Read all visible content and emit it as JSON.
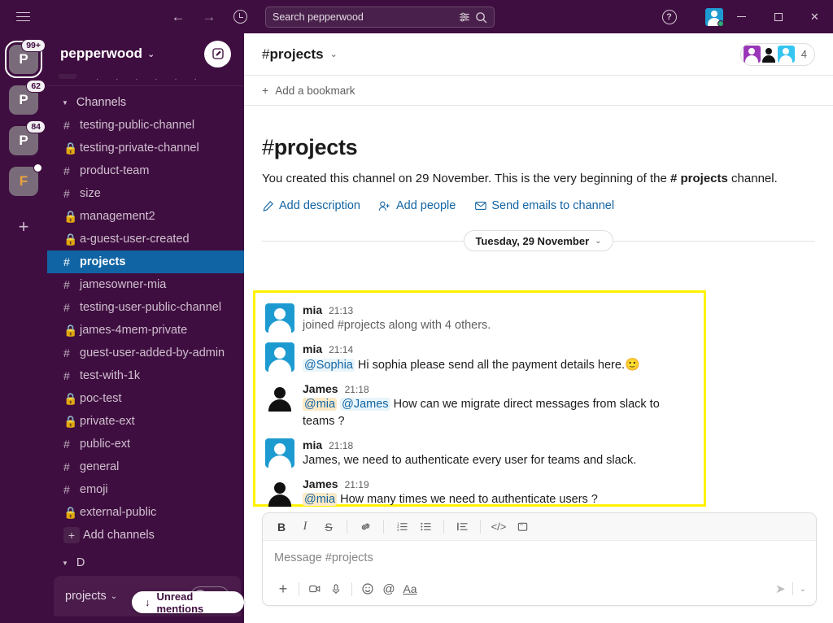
{
  "titlebar": {
    "menu_icon": "hamburger-icon",
    "back_icon": "arrow-left-icon",
    "forward_icon": "arrow-right-icon",
    "history_icon": "clock-icon",
    "search_placeholder": "Search pepperwood",
    "filter_icon": "search-filter-icon",
    "search_icon": "search-icon",
    "help_label": "?",
    "minimize_label": "minimize",
    "maximize_label": "maximize",
    "close_label": "✕"
  },
  "rail": {
    "workspaces": [
      {
        "letter": "P",
        "badge": "99+",
        "active": true,
        "dot": false
      },
      {
        "letter": "P",
        "badge": "62",
        "active": false,
        "dot": false
      },
      {
        "letter": "P",
        "badge": "84",
        "active": false,
        "dot": false
      },
      {
        "letter": "F",
        "badge": "",
        "active": false,
        "dot": true
      }
    ],
    "add_label": "+"
  },
  "sidebar": {
    "workspace_name": "pepperwood",
    "caret": "⌄",
    "compose_icon": "compose-icon",
    "section": {
      "label": "Channels",
      "expanded_caret": "▼"
    },
    "channels": [
      {
        "name": "testing-public-channel",
        "type": "public",
        "selected": false
      },
      {
        "name": "testing-private-channel",
        "type": "private",
        "selected": false
      },
      {
        "name": "product-team",
        "type": "public",
        "selected": false
      },
      {
        "name": "size",
        "type": "public",
        "selected": false
      },
      {
        "name": "management2",
        "type": "private",
        "selected": false
      },
      {
        "name": "a-guest-user-created",
        "type": "private",
        "selected": false
      },
      {
        "name": "projects",
        "type": "public",
        "selected": true
      },
      {
        "name": "jamesowner-mia",
        "type": "public",
        "selected": false
      },
      {
        "name": "testing-user-public-channel",
        "type": "public",
        "selected": false
      },
      {
        "name": "james-4mem-private",
        "type": "private",
        "selected": false
      },
      {
        "name": "guest-user-added-by-admin",
        "type": "public",
        "selected": false
      },
      {
        "name": "test-with-1k",
        "type": "public",
        "selected": false
      },
      {
        "name": "poc-test",
        "type": "private",
        "selected": false
      },
      {
        "name": "private-ext",
        "type": "private",
        "selected": false
      },
      {
        "name": "public-ext",
        "type": "public",
        "selected": false
      },
      {
        "name": "general",
        "type": "public",
        "selected": false
      },
      {
        "name": "emoji",
        "type": "public",
        "selected": false
      },
      {
        "name": "external-public",
        "type": "private",
        "selected": false
      }
    ],
    "add_channels_label": "Add channels",
    "unread_mentions_label": "Unread mentions",
    "unread_mentions_arrow": "↓",
    "footer": {
      "label": "projects",
      "caret": "⌄",
      "headphones_icon": "headphones-icon"
    }
  },
  "channel_header": {
    "hash": "#",
    "name": "projects",
    "caret": "⌄",
    "member_count": "4",
    "bookmark_plus": "+",
    "bookmark_label": "Add a bookmark"
  },
  "intro": {
    "hash": "#",
    "title": "projects",
    "body_part1": "You created this channel on 29 November. This is the very beginning of the ",
    "body_bold": "# projects",
    "body_part2": " channel.",
    "actions": [
      {
        "icon": "pencil-icon",
        "label": "Add description"
      },
      {
        "icon": "add-person-icon",
        "label": "Add people"
      },
      {
        "icon": "email-icon",
        "label": "Send emails to channel"
      }
    ]
  },
  "date_divider": {
    "label": "Tuesday, 29 November",
    "caret": "⌄"
  },
  "messages": [
    {
      "author": "mia",
      "time": "21:13",
      "avatar": "blue",
      "system": true,
      "text": "joined #projects along with 4 others.",
      "mentions": []
    },
    {
      "author": "mia",
      "time": "21:14",
      "avatar": "blue",
      "system": false,
      "mention1": "@Sophia",
      "text": "Hi sophia please send all the payment details here.",
      "emoji": "🙂"
    },
    {
      "author": "James",
      "time": "21:18",
      "avatar": "dark",
      "system": false,
      "mention1": "@mia",
      "mention2": "@James",
      "text": "How can we migrate direct messages from slack to teams ?"
    },
    {
      "author": "mia",
      "time": "21:18",
      "avatar": "blue",
      "system": false,
      "text": "James, we need to authenticate every user for teams and slack."
    },
    {
      "author": "James",
      "time": "21:19",
      "avatar": "dark",
      "system": false,
      "mention1": "@mia",
      "text": "How many times we need to authenticate users ?"
    }
  ],
  "composer": {
    "placeholder": "Message #projects",
    "toolbar": [
      {
        "icon": "bold-icon",
        "label": "B"
      },
      {
        "icon": "italic-icon",
        "label": "I"
      },
      {
        "icon": "strikethrough-icon",
        "label": "S"
      },
      {
        "icon": "link-icon",
        "label": "link"
      },
      {
        "icon": "ordered-list-icon",
        "label": "ol"
      },
      {
        "icon": "bulleted-list-icon",
        "label": "ul"
      },
      {
        "icon": "blockquote-icon",
        "label": "quote"
      },
      {
        "icon": "code-icon",
        "label": "</>"
      },
      {
        "icon": "code-block-icon",
        "label": "codeblock"
      }
    ],
    "bottom": [
      {
        "icon": "plus-icon",
        "label": "+"
      },
      {
        "icon": "video-icon",
        "label": "video"
      },
      {
        "icon": "microphone-icon",
        "label": "mic"
      },
      {
        "icon": "emoji-icon",
        "label": "emoji"
      },
      {
        "icon": "mention-icon",
        "label": "@"
      },
      {
        "icon": "format-text-icon",
        "label": "Aa"
      }
    ],
    "send_icon": "send-icon",
    "send_caret": "⌄"
  },
  "colors": {
    "sidebar_purple": "#3F0E40",
    "selected_channel_blue": "#1164A3",
    "highlight_yellow": "#FFF200",
    "link_blue": "#1264A3",
    "avatar_blue": "#1D9BD1"
  }
}
